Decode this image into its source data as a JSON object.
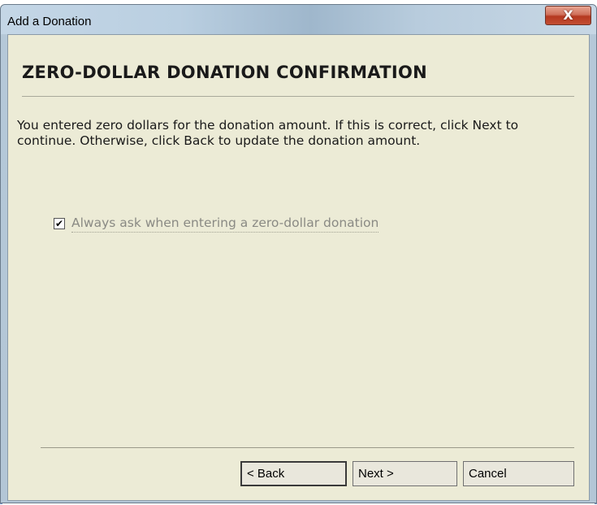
{
  "window": {
    "title": "Add a Donation",
    "close_glyph": "X"
  },
  "page": {
    "title": "ZERO-DOLLAR DONATION CONFIRMATION",
    "description": "You entered zero dollars for the donation amount. If this is correct, click Next to continue. Otherwise, click Back to update the donation amount."
  },
  "checkbox": {
    "label": "Always ask when entering a zero-dollar donation",
    "checked": true,
    "glyph": "✔"
  },
  "buttons": {
    "back": "< Back",
    "next": "Next >",
    "cancel": "Cancel"
  },
  "colors": {
    "panel_background": "#ecebd6",
    "close_button": "#c24e33",
    "disabled_text": "#8a8a84"
  }
}
